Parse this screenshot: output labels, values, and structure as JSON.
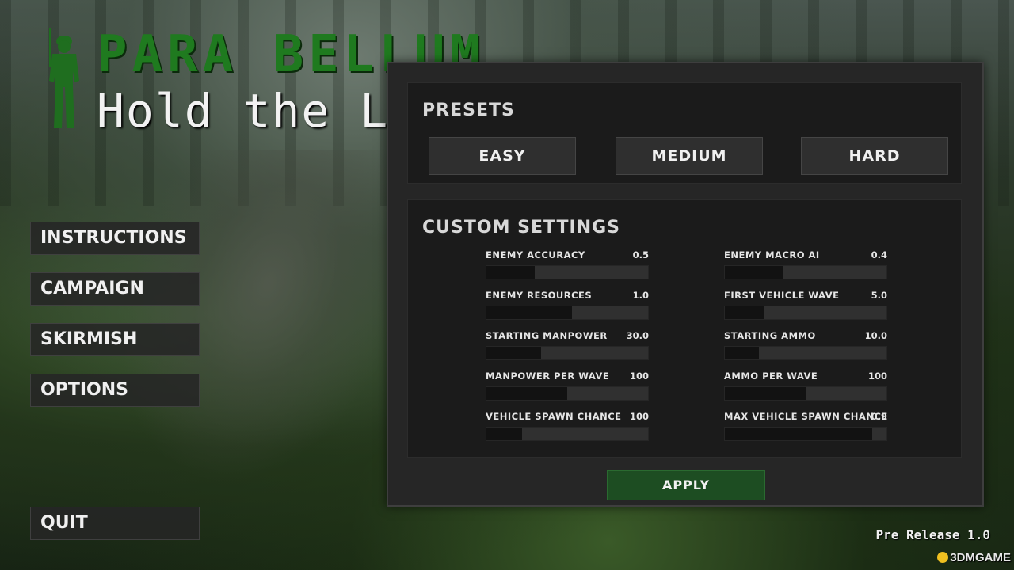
{
  "logo": {
    "title": "PARA BELLUM",
    "subtitle": "Hold the Line"
  },
  "menu": {
    "items": [
      {
        "label": "INSTRUCTIONS"
      },
      {
        "label": "CAMPAIGN"
      },
      {
        "label": "SKIRMISH"
      },
      {
        "label": "OPTIONS"
      }
    ],
    "quit_label": "QUIT"
  },
  "presets": {
    "title": "PRESETS",
    "buttons": [
      "EASY",
      "MEDIUM",
      "HARD"
    ]
  },
  "custom": {
    "title": "CUSTOM SETTINGS",
    "left": [
      {
        "label": "ENEMY ACCURACY",
        "value": "0.5",
        "fill": 0.3
      },
      {
        "label": "ENEMY RESOURCES",
        "value": "1.0",
        "fill": 0.53
      },
      {
        "label": "STARTING MANPOWER",
        "value": "30.0",
        "fill": 0.34
      },
      {
        "label": "MANPOWER PER WAVE",
        "value": "100",
        "fill": 0.5
      },
      {
        "label": "VEHICLE SPAWN CHANCE",
        "value": "100",
        "fill": 0.22
      }
    ],
    "right": [
      {
        "label": "ENEMY MACRO AI",
        "value": "0.4",
        "fill": 0.36
      },
      {
        "label": "FIRST VEHICLE WAVE",
        "value": "5.0",
        "fill": 0.24
      },
      {
        "label": "STARTING AMMO",
        "value": "10.0",
        "fill": 0.21
      },
      {
        "label": "AMMO PER WAVE",
        "value": "100",
        "fill": 0.5
      },
      {
        "label": "MAX VEHICLE SPAWN CHANCE",
        "value": "0.9",
        "fill": 0.91
      }
    ]
  },
  "apply_label": "APPLY",
  "version": "Pre Release 1.0",
  "watermark": "3DMGAME",
  "colors": {
    "logo_green": "#1f7a1f",
    "apply_green": "#1d4d22"
  }
}
